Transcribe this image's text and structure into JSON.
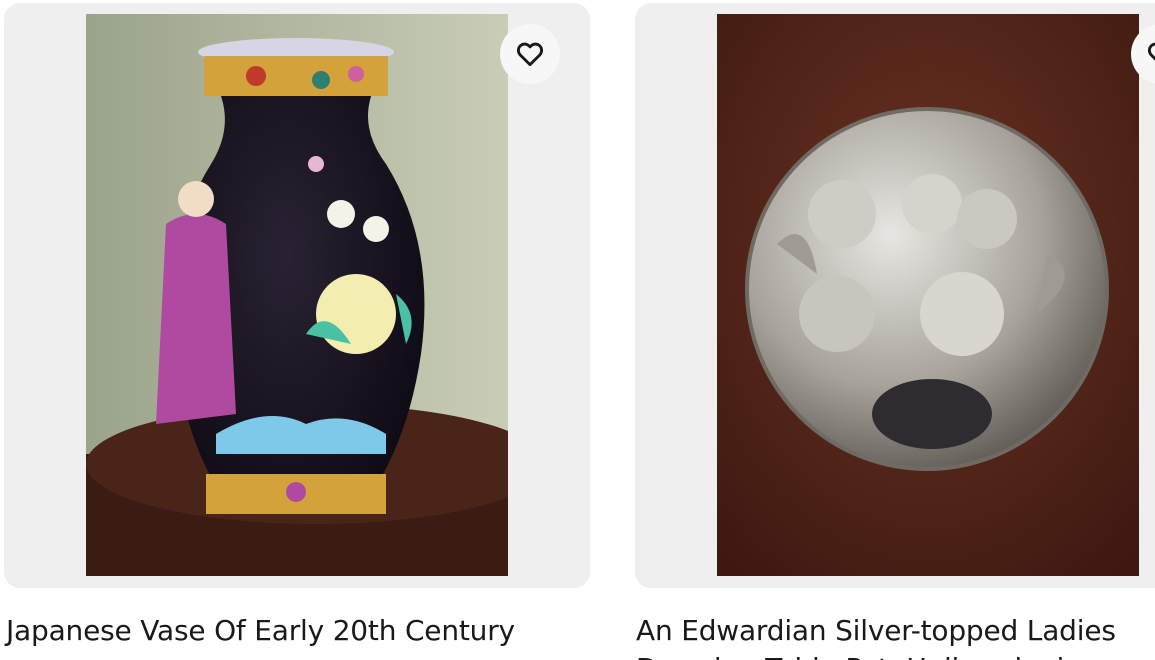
{
  "listings": [
    {
      "title": "Japanese Vase Of Early 20th Century",
      "image_alt": "Japanese vase photo",
      "watch_icon": "heart-outline-icon"
    },
    {
      "title": "An Edwardian Silver-topped Ladies",
      "title_line2": "Dressing Table Pot, Hallmarked...",
      "image_alt": "Silver-topped pot photo",
      "watch_icon": "heart-outline-icon"
    }
  ],
  "colors": {
    "card_background": "#efefef",
    "button_background": "#f7f7f7",
    "text": "#191919"
  }
}
